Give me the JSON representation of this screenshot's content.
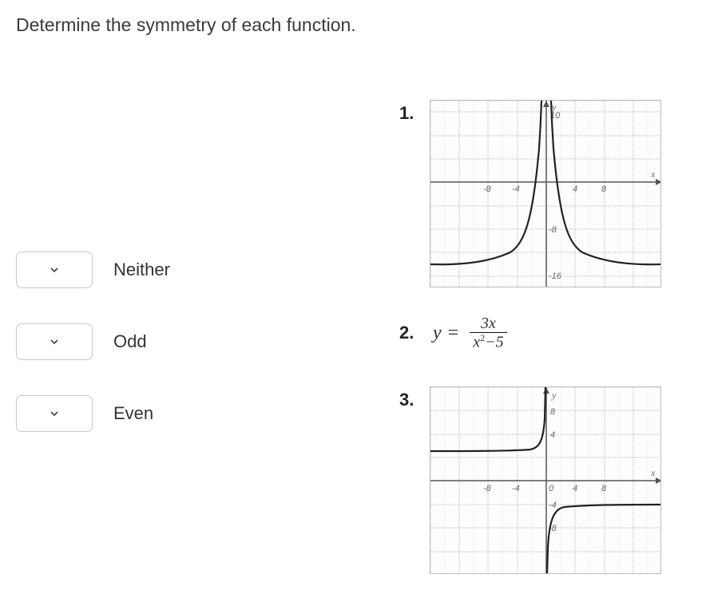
{
  "title": "Determine the symmetry of each function.",
  "answers": [
    {
      "label": "Neither"
    },
    {
      "label": "Odd"
    },
    {
      "label": "Even"
    }
  ],
  "problems": {
    "p1": {
      "number": "1."
    },
    "p2": {
      "number": "2.",
      "lhs": "y",
      "eq": "=",
      "num": "3x",
      "den_a": "x",
      "den_exp": "2",
      "den_rest": "−5"
    },
    "p3": {
      "number": "3."
    }
  },
  "graph1": {
    "xticks": {
      "n8": "-8",
      "n4": "-4",
      "p4": "4",
      "p8": "8"
    },
    "yticks": {
      "t10": "10",
      "n8": "-8",
      "n16": "-16"
    },
    "xletter": "x",
    "yletter": "y"
  },
  "graph3": {
    "xticks": {
      "n8": "-8",
      "n4": "-4",
      "zero": "0",
      "p4": "4",
      "p8": "8"
    },
    "yticks": {
      "p8": "8",
      "p4": "4",
      "n4": "-4",
      "n8": "-8"
    },
    "xletter": "x",
    "yletter": "y"
  }
}
